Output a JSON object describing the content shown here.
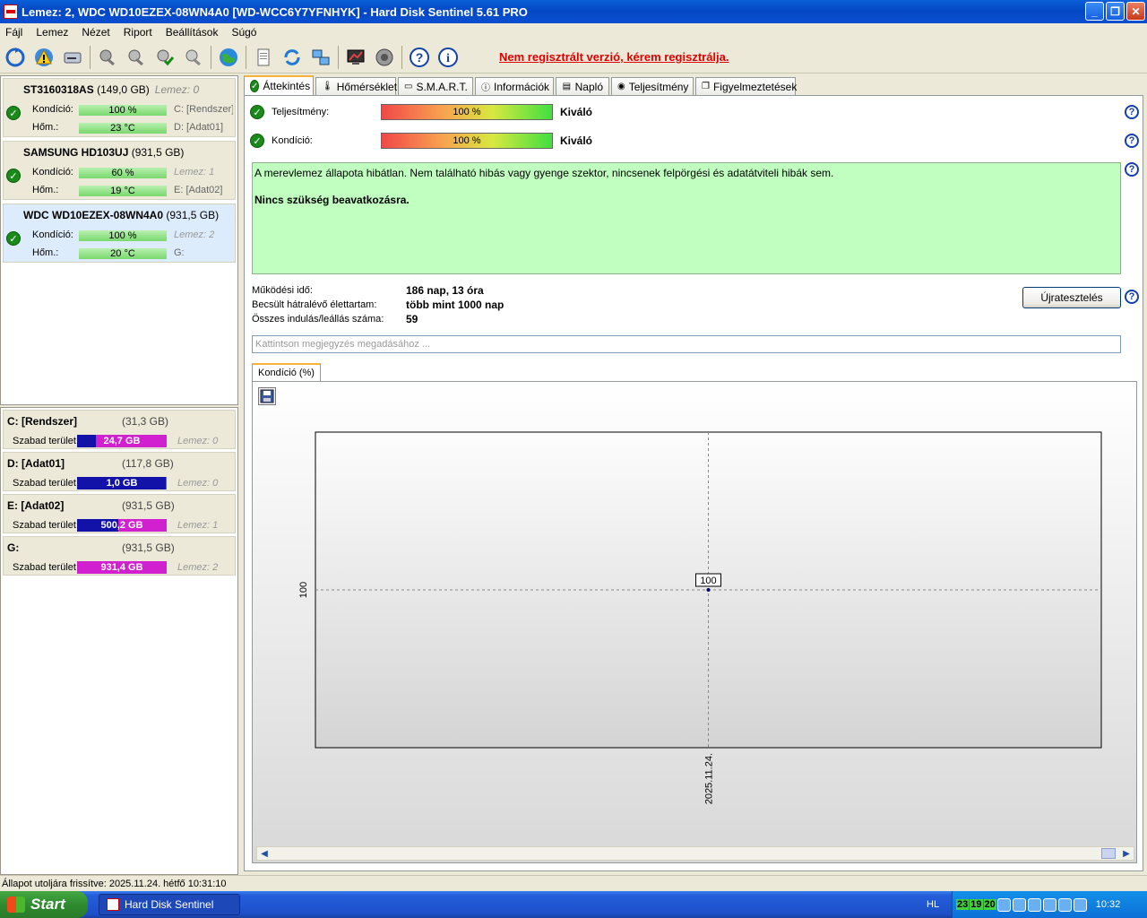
{
  "window": {
    "title": "Lemez: 2, WDC WD10EZEX-08WN4A0 [WD-WCC6Y7YFNHYK]  -  Hard Disk Sentinel 5.61 PRO",
    "minimize": "_",
    "maximize": "❐",
    "close": "✕"
  },
  "menu": [
    "Fájl",
    "Lemez",
    "Nézet",
    "Riport",
    "Beállítások",
    "Súgó"
  ],
  "toolbar": {
    "warning_link": "Nem regisztrált verzió, kérem regisztrálja."
  },
  "disks": [
    {
      "name": "ST3160318AS",
      "size": "(149,0 GB)",
      "lemez": "Lemez: 0",
      "kondicio_label": "Kondíció:",
      "kondicio": "100 %",
      "kondicio_pct": 100,
      "hom_label": "Hőm.:",
      "hom": "23 °C",
      "side1": "C: [Rendszer],",
      "side2": "D: [Adat01]"
    },
    {
      "name": "SAMSUNG HD103UJ",
      "size": "(931,5 GB)",
      "lemez": "",
      "kondicio_label": "Kondíció:",
      "kondicio": "60 %",
      "kondicio_pct": 60,
      "hom_label": "Hőm.:",
      "hom": "19 °C",
      "side1": "Lemez: 1",
      "side2": "E: [Adat02]"
    },
    {
      "name": "WDC WD10EZEX-08WN4A0",
      "size": "(931,5 GB)",
      "lemez": "",
      "kondicio_label": "Kondíció:",
      "kondicio": "100 %",
      "kondicio_pct": 100,
      "hom_label": "Hőm.:",
      "hom": "20 °C",
      "side1": "Lemez: 2",
      "side2": "G:"
    }
  ],
  "volumes": [
    {
      "name": "C: [Rendszer]",
      "size": "(31,3 GB)",
      "free_label": "Szabad terület",
      "free": "24,7 GB",
      "used_pct": 21,
      "lemez": "Lemez: 0"
    },
    {
      "name": "D: [Adat01]",
      "size": "(117,8 GB)",
      "free_label": "Szabad terület",
      "free": "1,0 GB",
      "used_pct": 99,
      "lemez": "Lemez: 0"
    },
    {
      "name": "E: [Adat02]",
      "size": "(931,5 GB)",
      "free_label": "Szabad terület",
      "free": "500,2 GB",
      "used_pct": 46,
      "lemez": "Lemez: 1"
    },
    {
      "name": "G:",
      "size": "(931,5 GB)",
      "free_label": "Szabad terület",
      "free": "931,4 GB",
      "used_pct": 0,
      "lemez": "Lemez: 2"
    }
  ],
  "tabs": [
    "Áttekintés",
    "Hőmérséklet",
    "S.M.A.R.T.",
    "Információk",
    "Napló",
    "Teljesítmény",
    "Figyelmeztetések"
  ],
  "overview": {
    "perf_label": "Teljesítmény:",
    "perf_value": "100 %",
    "perf_pct": 100,
    "perf_text": "Kiváló",
    "cond_label": "Kondíció:",
    "cond_value": "100 %",
    "cond_pct": 100,
    "cond_text": "Kiváló",
    "message1": "A merevlemez állapota hibátlan. Nem található hibás vagy gyenge szektor, nincsenek felpörgési és adatátviteli hibák sem.",
    "message2": "Nincs szükség beavatkozásra.",
    "uptime_label": "Működési idő:",
    "uptime": "186 nap, 13 óra",
    "life_label": "Becsült hátralévő élettartam:",
    "life": "több mint 1000 nap",
    "starts_label": "Összes indulás/leállás száma:",
    "starts": "59",
    "retest_button": "Újratesztelés",
    "note_placeholder": "Kattintson megjegyzés megadásához ...",
    "help": "?"
  },
  "chart_tab": "Kondíció  (%)",
  "chart_data": {
    "type": "line",
    "x": [
      "2025.11.24."
    ],
    "series": [
      {
        "values": [
          100
        ]
      }
    ],
    "ylabel": "",
    "xlabel": "",
    "ytick": "100",
    "xtick": "2025.11.24.",
    "point_label": "100",
    "grid": true
  },
  "status": "Állapot utoljára frissítve: 2025.11.24. hétfő 10:31:10",
  "taskbar": {
    "start": "Start",
    "task": "Hard Disk Sentinel",
    "lang": "HL",
    "temps": [
      "23",
      "19",
      "20"
    ],
    "clock": "10:32"
  }
}
